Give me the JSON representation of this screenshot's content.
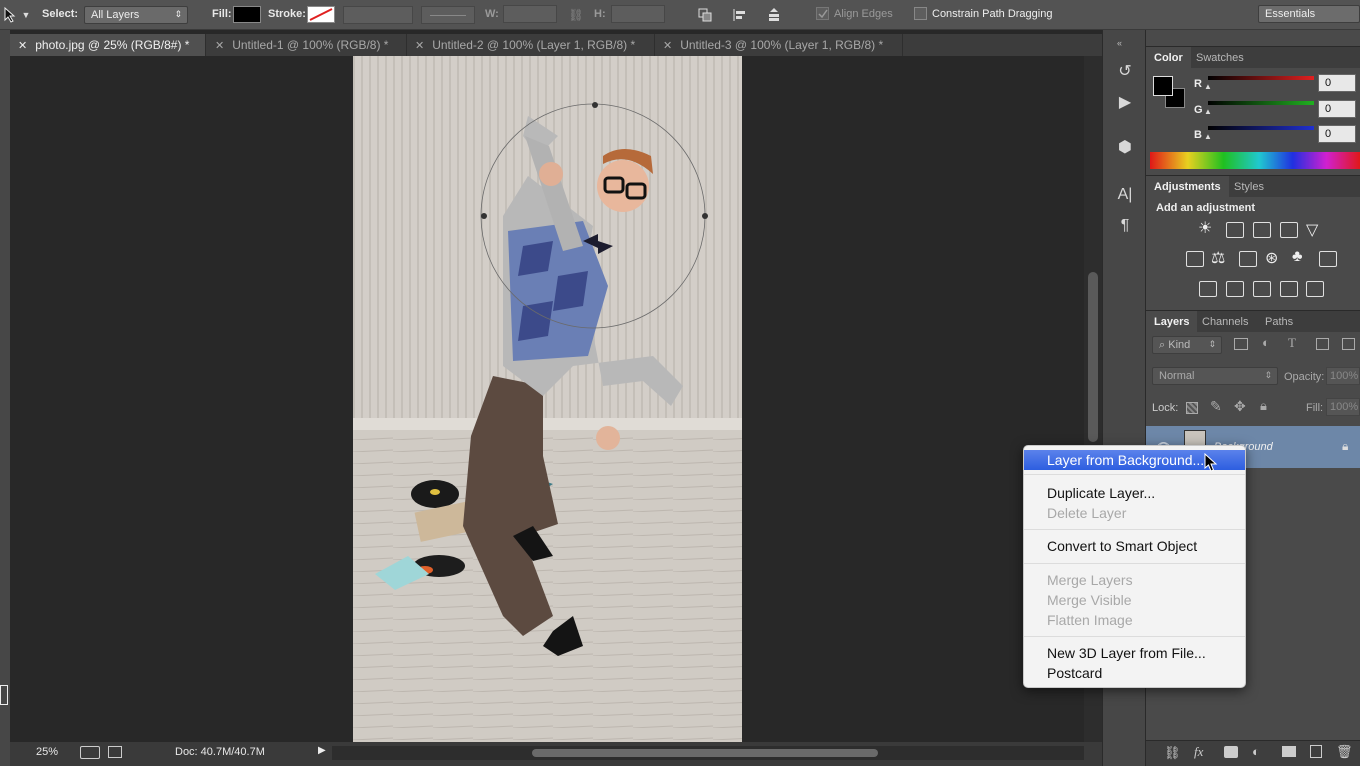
{
  "optbar": {
    "select_label": "Select:",
    "select_value": "All Layers",
    "fill_label": "Fill:",
    "stroke_label": "Stroke:",
    "w_label": "W:",
    "h_label": "H:",
    "align_edges_label": "Align Edges",
    "constrain_label": "Constrain Path Dragging",
    "workspace_value": "Essentials"
  },
  "tabs": [
    {
      "label": "photo.jpg @ 25% (RGB/8#) *",
      "active": true
    },
    {
      "label": "Untitled-1 @ 100% (RGB/8) *",
      "active": false
    },
    {
      "label": "Untitled-2 @ 100% (Layer 1, RGB/8) *",
      "active": false
    },
    {
      "label": "Untitled-3 @ 100% (Layer 1, RGB/8) *",
      "active": false
    }
  ],
  "status": {
    "zoom": "25%",
    "doc": "Doc: 40.7M/40.7M"
  },
  "color_panel": {
    "tabs": [
      "Color",
      "Swatches"
    ],
    "r_label": "R",
    "g_label": "G",
    "b_label": "B",
    "r_value": "0",
    "g_value": "0",
    "b_value": "0"
  },
  "adjust_panel": {
    "tabs": [
      "Adjustments",
      "Styles"
    ],
    "heading": "Add an adjustment"
  },
  "layers_panel": {
    "tabs": [
      "Layers",
      "Channels",
      "Paths"
    ],
    "kind_label": "Kind",
    "blend_mode": "Normal",
    "opacity_label": "Opacity:",
    "opacity_value": "100%",
    "lock_label": "Lock:",
    "fill_label": "Fill:",
    "fill_value": "100%",
    "layer_name": "Background"
  },
  "context_menu": {
    "items": [
      {
        "label": "Layer from Background...",
        "state": "highlighted"
      },
      {
        "label": "Duplicate Layer...",
        "state": "enabled"
      },
      {
        "label": "Delete Layer",
        "state": "disabled"
      },
      {
        "label": "Convert to Smart Object",
        "state": "enabled"
      },
      {
        "label": "Merge Layers",
        "state": "disabled"
      },
      {
        "label": "Merge Visible",
        "state": "disabled"
      },
      {
        "label": "Flatten Image",
        "state": "disabled"
      },
      {
        "label": "New 3D Layer from File...",
        "state": "enabled"
      },
      {
        "label": "Postcard",
        "state": "enabled"
      }
    ]
  },
  "colors": {
    "menu_highlight": "#3a68e4",
    "layer_row_selected": "#6d87a8",
    "r_slider": "#e02020",
    "g_slider": "#20b020",
    "b_slider": "#2030d0"
  }
}
